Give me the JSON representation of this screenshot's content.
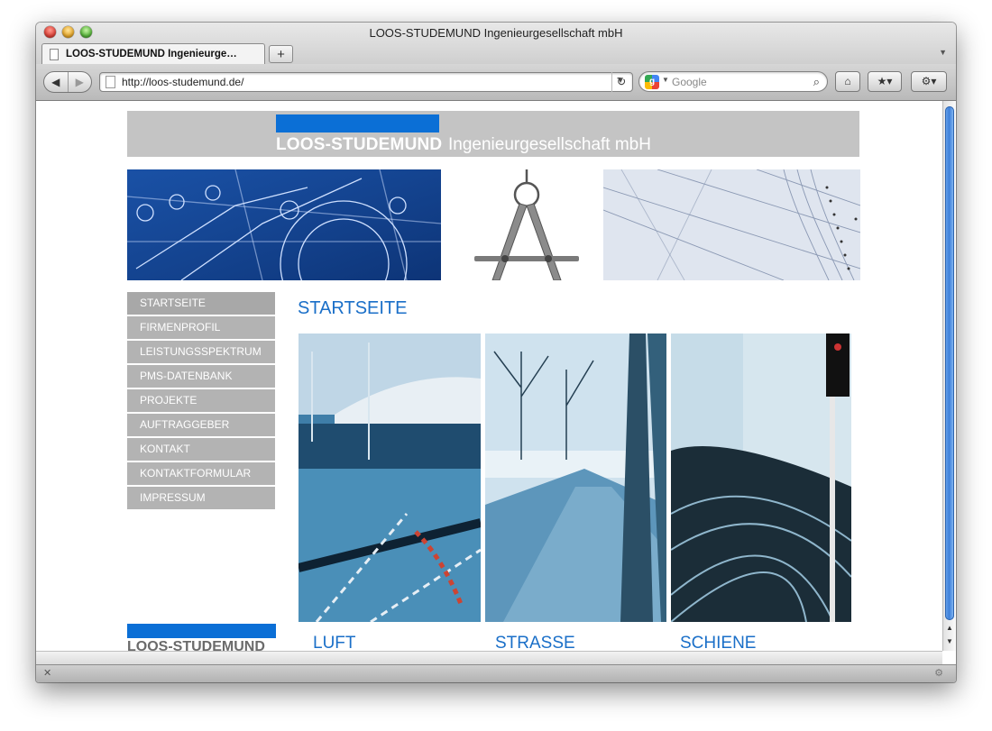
{
  "window": {
    "title": "LOOS-STUDEMUND Ingenieurgesellschaft mbH"
  },
  "tab": {
    "label": "LOOS-STUDEMUND Ingenieurge…",
    "new_tab": "+"
  },
  "toolbar": {
    "back": "◀",
    "forward": "▶",
    "url": "http://loos-studemund.de/",
    "url_dropdown": "▼",
    "reload": "↻",
    "search_engine": "g",
    "search_placeholder": "Google",
    "home": "⌂",
    "bookmarks": "★▾",
    "tools": "⚙▾"
  },
  "banner": {
    "name": "LOOS-STUDEMUND",
    "subtitle": "Ingenieurgesellschaft mbH"
  },
  "menu": {
    "items": [
      {
        "label": "STARTSEITE"
      },
      {
        "label": "FIRMENPROFIL"
      },
      {
        "label": "LEISTUNGSSPEKTRUM"
      },
      {
        "label": "PMS-DATENBANK"
      },
      {
        "label": "PROJEKTE"
      },
      {
        "label": "AUFTRAGGEBER"
      },
      {
        "label": "KONTAKT"
      },
      {
        "label": "KONTAKTFORMULAR"
      },
      {
        "label": "IMPRESSUM"
      }
    ]
  },
  "content": {
    "heading": "STARTSEITE",
    "captions": {
      "luft": "LUFT",
      "strasse": "STRASSE",
      "schiene": "SCHIENE"
    }
  },
  "footer": {
    "name": "LOOS-STUDEMUND"
  },
  "status": {
    "left": "✕",
    "right": "⚙"
  },
  "colors": {
    "accent": "#0b6fd6",
    "heading": "#1a6fc8",
    "menu_bg": "#b3b3b3",
    "banner_bg": "#c4c4c4"
  }
}
